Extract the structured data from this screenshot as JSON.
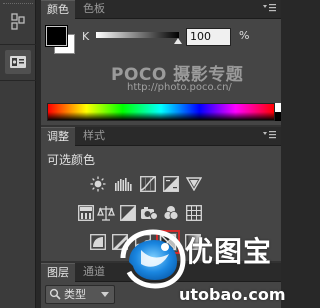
{
  "color_panel": {
    "tabs": [
      {
        "label": "颜色",
        "active": true
      },
      {
        "label": "色板",
        "active": false
      }
    ],
    "foreground_color": "#000000",
    "background_color": "#ffffff",
    "channel_label": "K",
    "channel_value": "100",
    "channel_unit": "%",
    "slider_level": 1.0
  },
  "watermark": {
    "title": "POCO 摄影专题",
    "url": "http://photo.poco.cn/"
  },
  "adjustments_panel": {
    "tabs": [
      {
        "label": "调整",
        "active": true
      },
      {
        "label": "样式",
        "active": false
      }
    ],
    "current_adjustment": "可选颜色",
    "highlight_color": "#d42a2a",
    "icon_rows": [
      [
        "brightness-contrast-icon",
        "levels-icon",
        "curves-icon",
        "exposure-icon",
        "vibrance-icon"
      ],
      [
        "hue-saturation-icon",
        "color-balance-icon",
        "black-white-icon",
        "photo-filter-icon",
        "channel-mixer-icon",
        "color-lookup-icon"
      ],
      [
        "invert-icon",
        "posterize-icon",
        "threshold-icon",
        "selective-color-icon",
        "gradient-map-icon"
      ]
    ]
  },
  "layers_panel": {
    "tabs": [
      {
        "label": "图层",
        "active": true
      },
      {
        "label": "通道",
        "active": false
      }
    ],
    "filter_kind": "类型"
  },
  "logo": {
    "brand": "优图宝",
    "domain": "utobao.com"
  }
}
